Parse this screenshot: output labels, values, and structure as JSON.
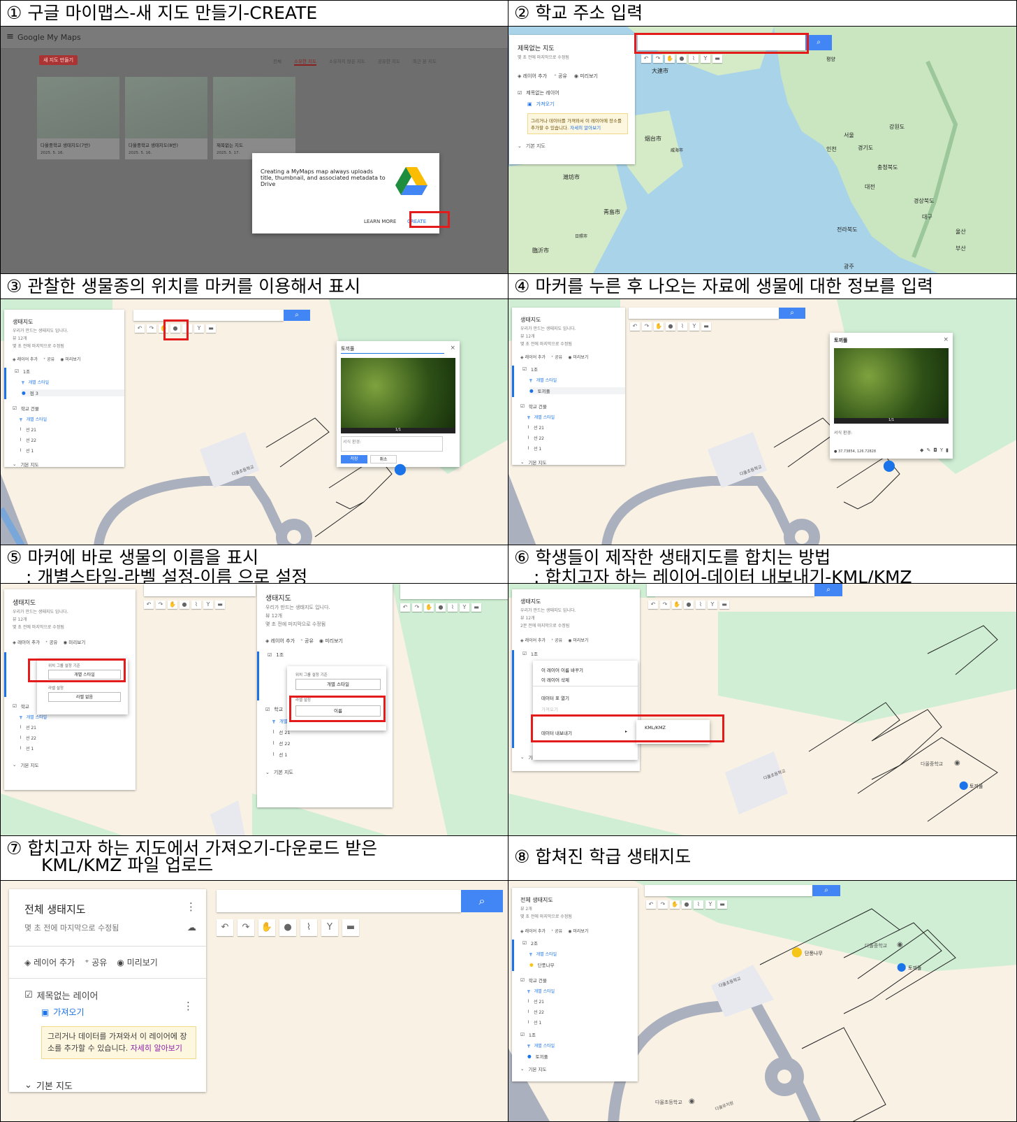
{
  "steps": [
    {
      "num": "①",
      "title": "구글 마이맵스-새 지도 만들기-CREATE"
    },
    {
      "num": "②",
      "title": "학교 주소 입력"
    },
    {
      "num": "③",
      "title": "관찰한 생물종의 위치를 마커를 이용해서 표시"
    },
    {
      "num": "④",
      "title": "마커를 누른 후 나오는 자료에 생물에 대한 정보를 입력"
    },
    {
      "num": "⑤",
      "title": "마커에 바로 생물의 이름을 표시",
      "subtitle": ": 개별스타일-라벨 설정-이름 으로 설정"
    },
    {
      "num": "⑥",
      "title": "학생들이 제작한 생태지도를 합치는 방법",
      "subtitle": ": 합치고자 하는 레이어-데이터 내보내기-KML/KMZ"
    },
    {
      "num": "⑦",
      "title": "합치고자  하는  지도에서  가져오기-다운로드  받은",
      "subtitle": "KML/KMZ 파일 업로드"
    },
    {
      "num": "⑧",
      "title": "합쳐진 학급 생태지도"
    }
  ],
  "s1": {
    "app_title": "Google My Maps",
    "new_map_btn": "새 지도 만들기",
    "tabs": [
      "전체",
      "소유한 지도",
      "소유하지 않은 지도",
      "공유한 지도",
      "최근 본 지도"
    ],
    "cards": [
      {
        "title": "다올중학교 생태지도(7반)",
        "date": "2025. 5. 16."
      },
      {
        "title": "다올중학교 생태지도(8반)",
        "date": "2025. 5. 16."
      },
      {
        "title": "제목없는 지도",
        "date": "2025. 5. 17."
      }
    ],
    "dialog_text": "Creating a MyMaps map always uploads title, thumbnail, and associated metadata to Drive",
    "learn_more": "LEARN MORE",
    "create": "CREATE"
  },
  "s2": {
    "panel_title": "제목없는 지도",
    "panel_sub": "몇 초 전에 마지막으로 수정됨",
    "actions": [
      "레이어 추가",
      "공유",
      "미리보기"
    ],
    "layer": "제목없는 레이어",
    "import": "가져오기",
    "hint": "그리거나 데이터를 가져와서 이 레이어에 장소를 추가할 수 있습니다.",
    "hint_link": "자세히 알아보기",
    "basemap": "기본 지도",
    "places": [
      "평양",
      "서울",
      "인천",
      "강원도",
      "경기도",
      "충청북도",
      "대전",
      "대구",
      "경상북도",
      "울산",
      "전라북도",
      "광주",
      "부산",
      "大連市",
      "烟台市",
      "威海市",
      "靑島市",
      "臨沂市",
      "日照市",
      "潍坊市"
    ]
  },
  "s3": {
    "panel_title": "생태지도",
    "panel_desc": "우리가 만드는 생태지도 입니다.",
    "views": "뷰 12개",
    "edited": "몇 초 전에 마지막으로 수정됨",
    "layer1": "1조",
    "style": "개별 스타일",
    "point": "점 3",
    "layer2": "학교 건물",
    "lines": [
      "선 21",
      "선 22",
      "선 1"
    ],
    "basemap": "기본 지도",
    "popup_title": "토끼풀",
    "counter": "1/1",
    "desc_placeholder": "서식 환경:",
    "save": "저장",
    "cancel": "취소",
    "school": "다올초등학교"
  },
  "s4": {
    "point": "토끼풀",
    "popup_title": "토끼풀",
    "counter": "1/1",
    "desc": "서식 환경:",
    "coords": "37.73854, 126.72828"
  },
  "s5": {
    "group_by": "위치 그룹 설정 기준",
    "style_value": "개별 스타일",
    "label_setting": "라벨 설정",
    "label_none": "라벨 없음",
    "label_name": "이름",
    "school_short": "학교",
    "one": "1조"
  },
  "s6": {
    "edited": "2분 전에 마지막으로 수정됨",
    "menu": [
      "이 레이어 이름 바꾸기",
      "이 레이어 삭제",
      "데이터 표 열기",
      "가져오기",
      "데이터 내보내기"
    ],
    "export_label": "데이터 내보내기",
    "submenu": "KML/KMZ",
    "school_mid": "다올중학교",
    "rabbit": "토끼풀"
  },
  "s7": {
    "panel_title": "전체 생태지도",
    "panel_sub": "몇 초 전에 마지막으로 수정됨"
  },
  "s8": {
    "views": "뷰 2개",
    "layer_a": "2조",
    "point_a": "단풍나무",
    "layer_c": "1조",
    "point_c": "토끼풀",
    "school_elem": "다올초등학교",
    "school_mid": "다올중학교",
    "kinder": "다올유치원"
  },
  "colors": {
    "accent_red": "#e31b1b",
    "google_blue": "#4285f4",
    "map_green": "#cfeed4",
    "map_bg": "#f8f1e4"
  }
}
